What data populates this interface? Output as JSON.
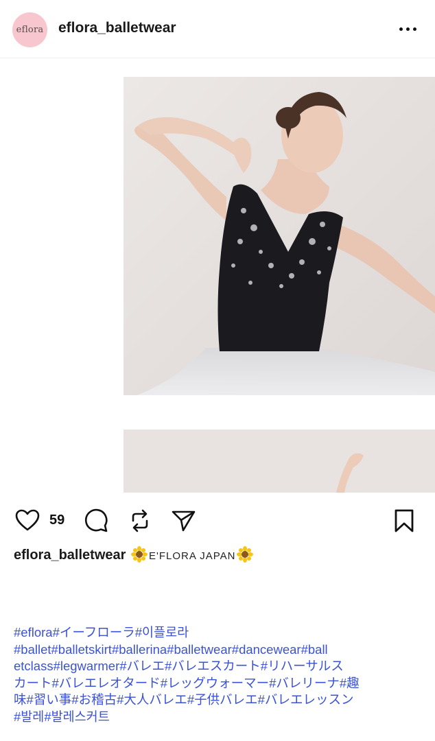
{
  "header": {
    "avatar_text": "eflora",
    "username": "eflora_balletwear"
  },
  "actions": {
    "like_count": "59"
  },
  "caption": {
    "username": "eflora_balletwear",
    "brand": "E'FLORA JAPAN"
  },
  "hashtags": [
    "#eflora#イーフローラ#이플로라",
    "#ballet#balletskirt#ballerina#balletwear#dancewear#ball",
    "etclass#legwarmer#バレエ#バレエスカート#リハーサルス",
    "カート#バレエレオタード#レッグウォーマー#バレリーナ#趣",
    "味#習い事#お稽古#大人バレエ#子供バレエ#バレエレッスン",
    "#발레#발레스커트"
  ],
  "colors": {
    "avatar_bg": "#f7c6cf",
    "hashtag": "#3b52d6",
    "leotard": "#1b1b1f",
    "backdrop": "#e6e1df"
  },
  "icons": [
    "more-horizontal-icon",
    "heart-icon",
    "comment-icon",
    "repost-icon",
    "share-icon",
    "bookmark-icon",
    "sunflower-emoji"
  ]
}
